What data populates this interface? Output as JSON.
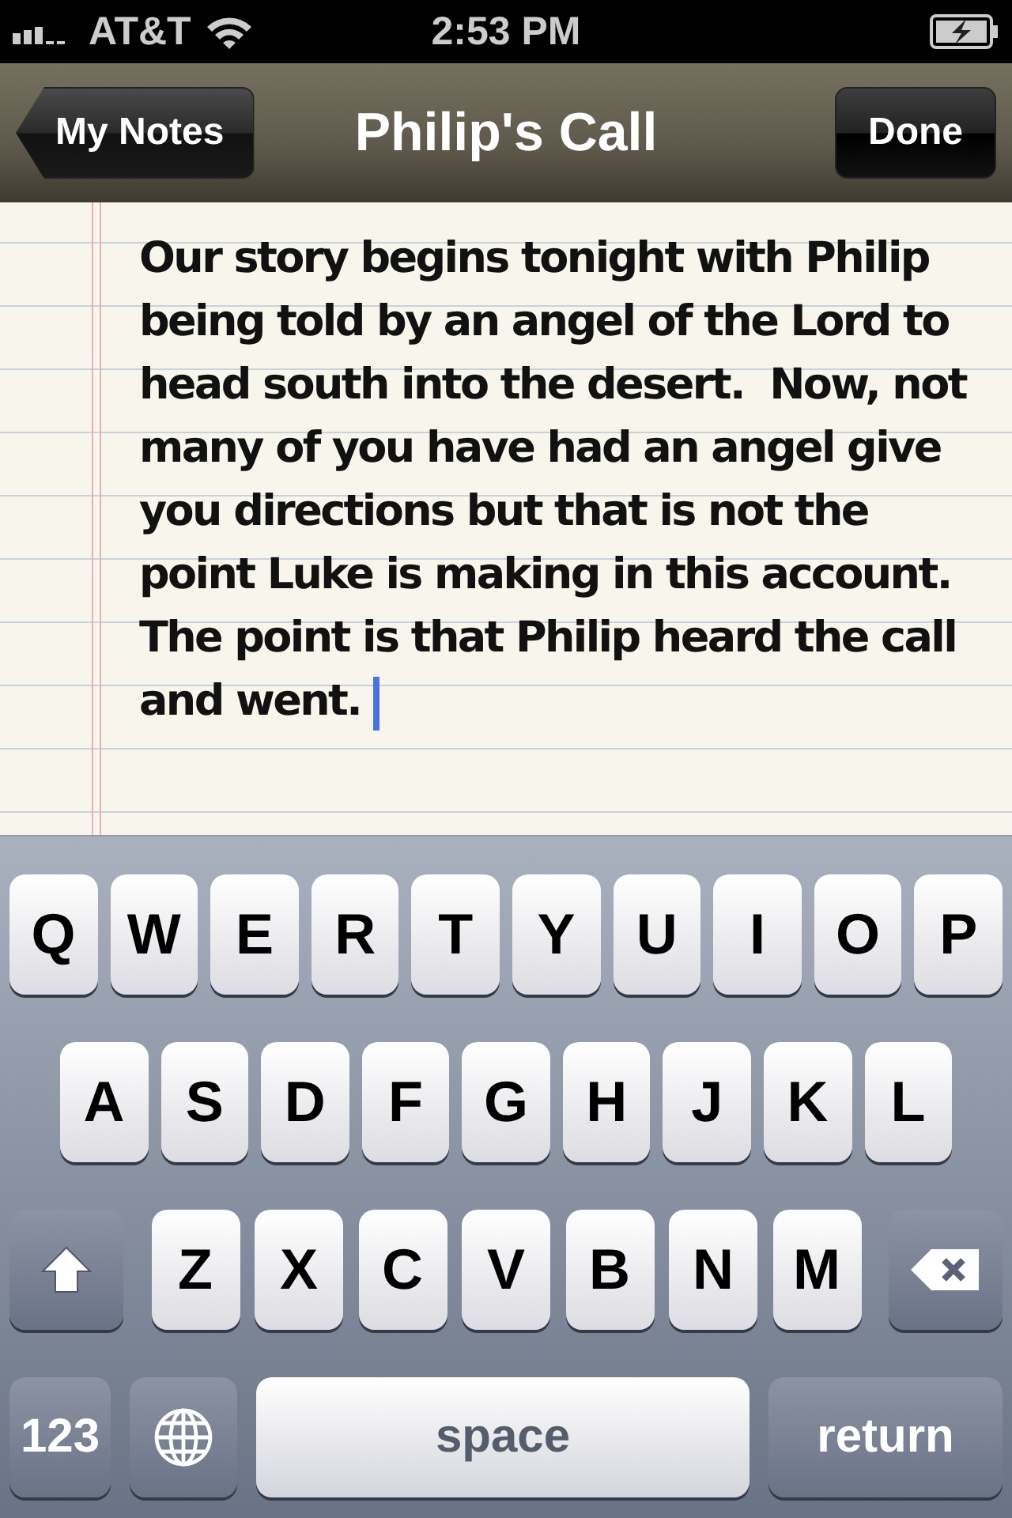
{
  "status_bar": {
    "carrier": "AT&T",
    "time": "2:53 PM"
  },
  "nav": {
    "back": "My Notes",
    "title": "Philip's Call",
    "done": "Done"
  },
  "note": {
    "text": "Our story begins tonight with Philip being told by an angel of the Lord to head south into the desert.  Now, not many of you have had an angel give you directions but that is not the point Luke is making in this account.  The point is that Philip heard the call and went."
  },
  "keyboard": {
    "rows": [
      {
        "keys": [
          {
            "kind": "letter",
            "label": "Q"
          },
          {
            "kind": "letter",
            "label": "W"
          },
          {
            "kind": "letter",
            "label": "E"
          },
          {
            "kind": "letter",
            "label": "R"
          },
          {
            "kind": "letter",
            "label": "T"
          },
          {
            "kind": "letter",
            "label": "Y"
          },
          {
            "kind": "letter",
            "label": "U"
          },
          {
            "kind": "letter",
            "label": "I"
          },
          {
            "kind": "letter",
            "label": "O"
          },
          {
            "kind": "letter",
            "label": "P"
          }
        ]
      },
      {
        "keys": [
          {
            "kind": "letter",
            "label": "A"
          },
          {
            "kind": "letter",
            "label": "S"
          },
          {
            "kind": "letter",
            "label": "D"
          },
          {
            "kind": "letter",
            "label": "F"
          },
          {
            "kind": "letter",
            "label": "G"
          },
          {
            "kind": "letter",
            "label": "H"
          },
          {
            "kind": "letter",
            "label": "J"
          },
          {
            "kind": "letter",
            "label": "K"
          },
          {
            "kind": "letter",
            "label": "L"
          }
        ]
      },
      {
        "keys": [
          {
            "kind": "shift"
          },
          {
            "kind": "letter",
            "label": "Z"
          },
          {
            "kind": "letter",
            "label": "X"
          },
          {
            "kind": "letter",
            "label": "C"
          },
          {
            "kind": "letter",
            "label": "V"
          },
          {
            "kind": "letter",
            "label": "B"
          },
          {
            "kind": "letter",
            "label": "N"
          },
          {
            "kind": "letter",
            "label": "M"
          },
          {
            "kind": "delete"
          }
        ]
      },
      {
        "keys": [
          {
            "kind": "mode",
            "label": "123"
          },
          {
            "kind": "globe"
          },
          {
            "kind": "space",
            "label": "space"
          },
          {
            "kind": "return",
            "label": "return"
          }
        ]
      }
    ]
  }
}
